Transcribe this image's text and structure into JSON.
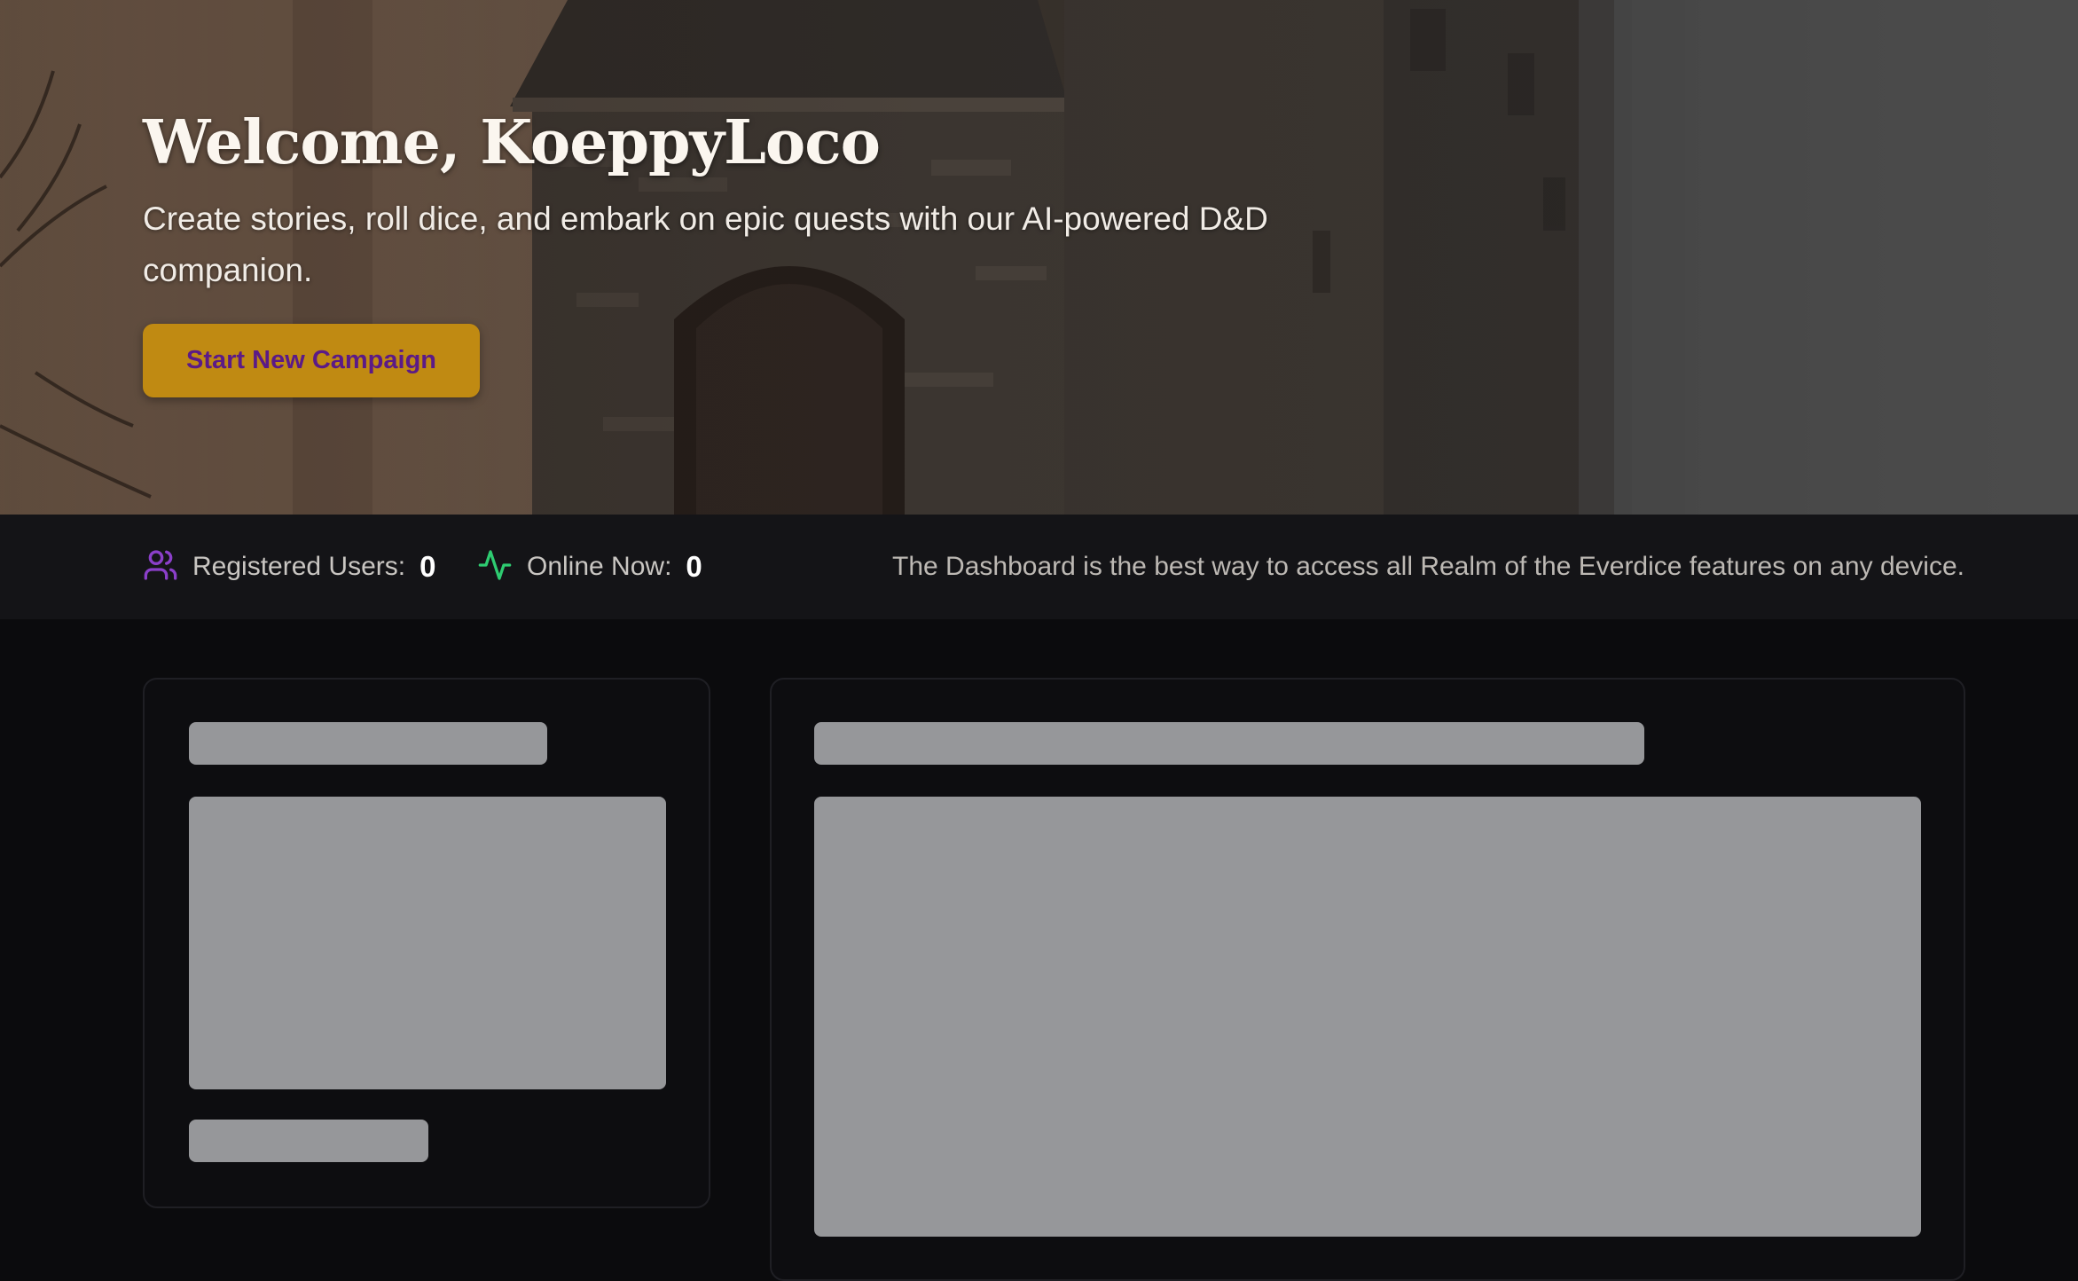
{
  "hero": {
    "title": "Welcome, KoeppyLoco",
    "subtitle": "Create stories, roll dice, and embark on epic quests with our AI-powered D&D companion.",
    "cta_label": "Start New Campaign"
  },
  "stats": {
    "registered_label": "Registered Users:",
    "registered_value": "0",
    "online_label": "Online Now:",
    "online_value": "0",
    "note": "The Dashboard is the best way to access all Realm of the Everdice features on any device."
  },
  "icons": {
    "users": "users-icon",
    "activity": "activity-icon"
  },
  "colors": {
    "accent_gold": "#c08a12",
    "accent_purple": "#5b1a87",
    "users_icon": "#8b3fc9",
    "activity_icon": "#2ecc71",
    "skeleton": "#96979a"
  }
}
